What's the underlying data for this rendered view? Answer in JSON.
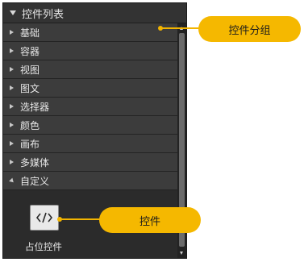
{
  "panel": {
    "title": "控件列表",
    "categories": [
      {
        "label": "基础",
        "expanded": false
      },
      {
        "label": "容器",
        "expanded": false
      },
      {
        "label": "视图",
        "expanded": false
      },
      {
        "label": "图文",
        "expanded": false
      },
      {
        "label": "选择器",
        "expanded": false
      },
      {
        "label": "颜色",
        "expanded": false
      },
      {
        "label": "画布",
        "expanded": false
      },
      {
        "label": "多媒体",
        "expanded": false
      },
      {
        "label": "自定义",
        "expanded": true
      }
    ],
    "custom_items": [
      {
        "label": "占位控件",
        "icon": "code-brackets-icon"
      }
    ]
  },
  "callouts": {
    "group": "控件分组",
    "control": "控件"
  },
  "colors": {
    "panel_bg": "#2b2b2b",
    "row_bg": "#3c3c3c",
    "accent": "#f5b800"
  }
}
